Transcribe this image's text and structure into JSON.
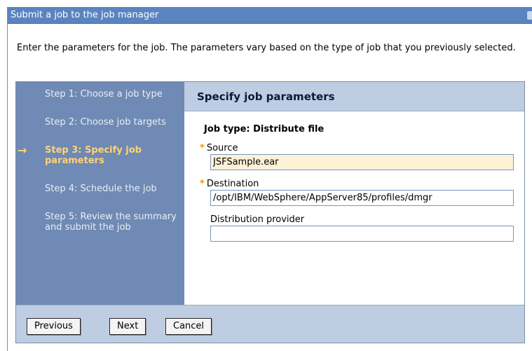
{
  "window": {
    "title": "Submit a job to the job manager"
  },
  "intro": "Enter the parameters for the job. The parameters vary based on the type of job that you previously selected.",
  "steps": [
    {
      "label": "Step 1: Choose a job type"
    },
    {
      "label": "Step 2: Choose job targets"
    },
    {
      "label": "Step 3: Specify job parameters"
    },
    {
      "label": "Step 4: Schedule the job"
    },
    {
      "label": "Step 5: Review the summary and submit the job"
    }
  ],
  "current_step_marker": "→",
  "content": {
    "header": "Specify job parameters",
    "job_type": "Job type: Distribute file",
    "required_marker": "*",
    "fields": {
      "source": {
        "label": "Source",
        "value": "JSFSample.ear"
      },
      "destination": {
        "label": "Destination",
        "value": "/opt/IBM/WebSphere/AppServer85/profiles/dmgr"
      },
      "provider": {
        "label": "Distribution provider",
        "value": ""
      }
    }
  },
  "buttons": {
    "previous": "Previous",
    "next": "Next",
    "cancel": "Cancel"
  },
  "colors": {
    "titlebar": "#5a84c0",
    "sidebar": "#6f8ab4",
    "current_step": "#ffd27a",
    "header_band": "#bfcde2",
    "filled_input": "#fdf2d6"
  }
}
